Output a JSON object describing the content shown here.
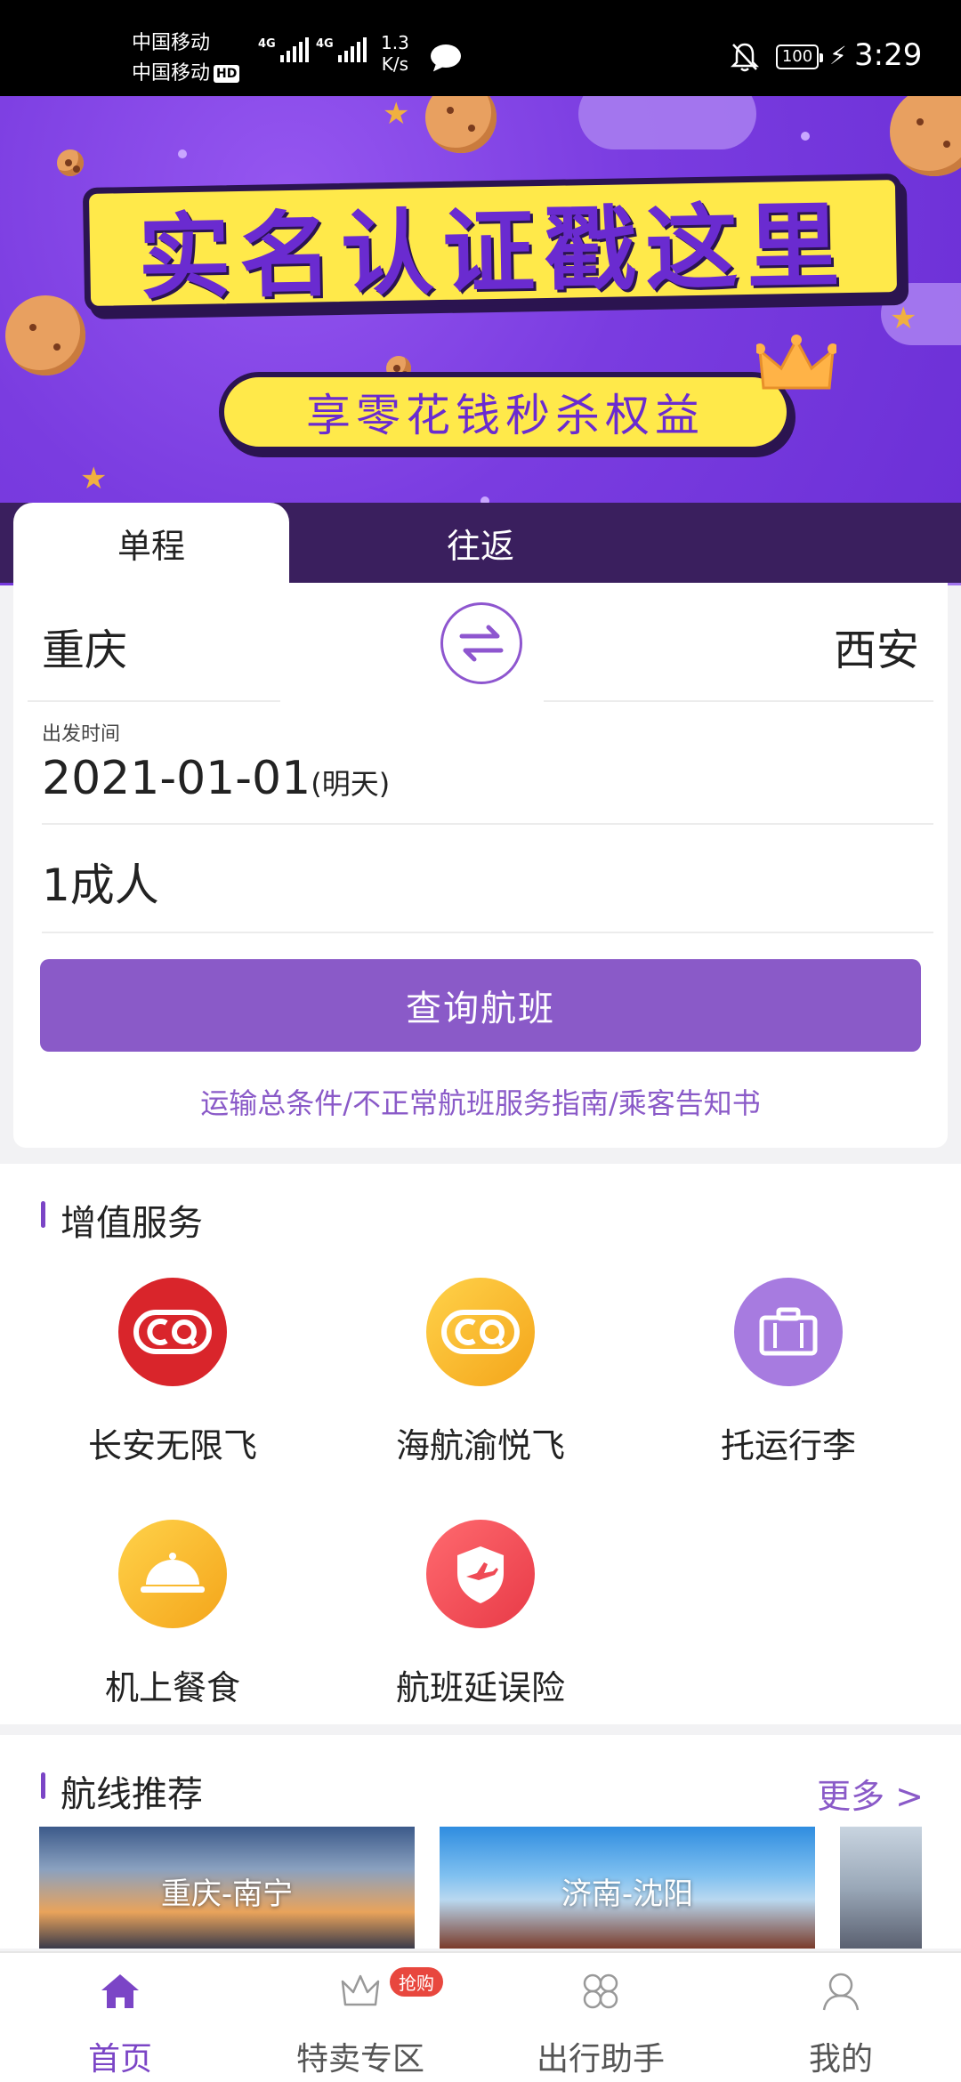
{
  "status_bar": {
    "carrier_1": "中国移动",
    "carrier_2": "中国移动",
    "hd": "HD",
    "net_1": "4G",
    "net_2": "4G",
    "speed_value": "1.3",
    "speed_unit": "K/s",
    "battery": "100",
    "time": "3:29"
  },
  "banner": {
    "headline": "实名认证戳这里",
    "subheadline": "享零花钱秒杀权益"
  },
  "trip_tabs": [
    {
      "label": "单程",
      "active": true
    },
    {
      "label": "往返",
      "active": false
    }
  ],
  "search_form": {
    "from_city": "重庆",
    "to_city": "西安",
    "date_label": "出发时间",
    "date_value": "2021-01-01",
    "date_note": "(明天)",
    "passengers": "1成人",
    "search_button": "查询航班",
    "links": "运输总条件/不正常航班服务指南/乘客告知书"
  },
  "services": {
    "title": "增值服务",
    "items": [
      {
        "label": "长安无限飞",
        "icon": "cq-red-logo-icon",
        "color": "#d9252b"
      },
      {
        "label": "海航渝悦飞",
        "icon": "cq-gold-logo-icon",
        "color": "#f6b81e"
      },
      {
        "label": "托运行李",
        "icon": "suitcase-icon",
        "color": "#a77be0"
      },
      {
        "label": "机上餐食",
        "icon": "food-cloche-icon",
        "color": "#f6b81e"
      },
      {
        "label": "航班延误险",
        "icon": "shield-plane-icon",
        "color": "#ef4a55"
      }
    ]
  },
  "routes": {
    "title": "航线推荐",
    "more": "更多 >",
    "items": [
      {
        "label": "重庆-南宁"
      },
      {
        "label": "济南-沈阳"
      },
      {
        "label": ""
      }
    ]
  },
  "tabbar": {
    "items": [
      {
        "label": "首页",
        "icon": "home-icon",
        "active": true
      },
      {
        "label": "特卖专区",
        "icon": "crown-icon",
        "badge": "抢购"
      },
      {
        "label": "出行助手",
        "icon": "grid-icon"
      },
      {
        "label": "我的",
        "icon": "user-icon"
      }
    ]
  },
  "colors": {
    "accent": "#8a5ac8",
    "tab_active": "#7b45c6",
    "banner_purple": "#7b3fe0",
    "banner_yellow": "#ffe94a"
  }
}
